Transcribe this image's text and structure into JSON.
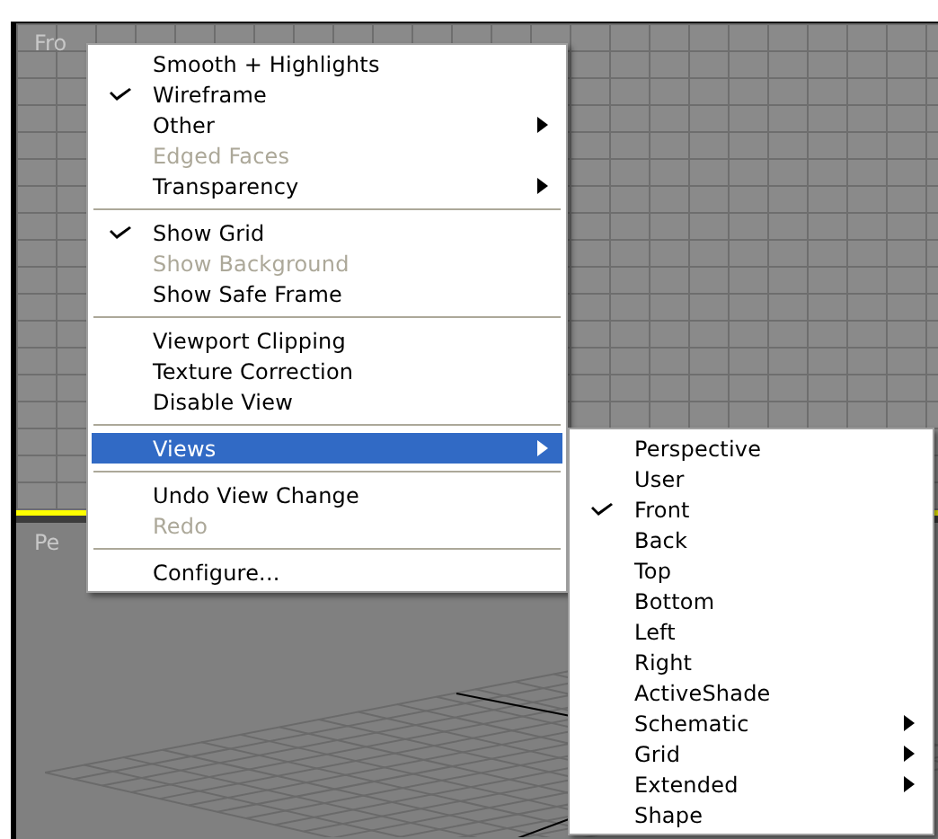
{
  "viewports": [
    {
      "label": "Fro",
      "kind": "orthographic",
      "active": true
    },
    {
      "label": "Pe",
      "kind": "perspective",
      "active": false
    }
  ],
  "menu": {
    "items": [
      {
        "kind": "item",
        "label": "Smooth + Highlights",
        "checked": false,
        "disabled": false,
        "submenu": false,
        "selected": false
      },
      {
        "kind": "item",
        "label": "Wireframe",
        "checked": true,
        "disabled": false,
        "submenu": false,
        "selected": false
      },
      {
        "kind": "item",
        "label": "Other",
        "checked": false,
        "disabled": false,
        "submenu": true,
        "selected": false
      },
      {
        "kind": "item",
        "label": "Edged Faces",
        "checked": false,
        "disabled": true,
        "submenu": false,
        "selected": false
      },
      {
        "kind": "item",
        "label": "Transparency",
        "checked": false,
        "disabled": false,
        "submenu": true,
        "selected": false
      },
      {
        "kind": "separator"
      },
      {
        "kind": "item",
        "label": "Show Grid",
        "checked": true,
        "disabled": false,
        "submenu": false,
        "selected": false
      },
      {
        "kind": "item",
        "label": "Show Background",
        "checked": false,
        "disabled": true,
        "submenu": false,
        "selected": false
      },
      {
        "kind": "item",
        "label": "Show Safe Frame",
        "checked": false,
        "disabled": false,
        "submenu": false,
        "selected": false
      },
      {
        "kind": "separator"
      },
      {
        "kind": "item",
        "label": "Viewport Clipping",
        "checked": false,
        "disabled": false,
        "submenu": false,
        "selected": false
      },
      {
        "kind": "item",
        "label": "Texture Correction",
        "checked": false,
        "disabled": false,
        "submenu": false,
        "selected": false
      },
      {
        "kind": "item",
        "label": "Disable View",
        "checked": false,
        "disabled": false,
        "submenu": false,
        "selected": false
      },
      {
        "kind": "separator"
      },
      {
        "kind": "item",
        "label": "Views",
        "checked": false,
        "disabled": false,
        "submenu": true,
        "selected": true
      },
      {
        "kind": "separator"
      },
      {
        "kind": "item",
        "label": "Undo View Change",
        "checked": false,
        "disabled": false,
        "submenu": false,
        "selected": false
      },
      {
        "kind": "item",
        "label": "Redo",
        "checked": false,
        "disabled": true,
        "submenu": false,
        "selected": false
      },
      {
        "kind": "separator"
      },
      {
        "kind": "item",
        "label": "Configure...",
        "checked": false,
        "disabled": false,
        "submenu": false,
        "selected": false
      }
    ]
  },
  "submenu": {
    "items": [
      {
        "kind": "item",
        "label": "Perspective",
        "checked": false,
        "disabled": false,
        "submenu": false,
        "selected": false
      },
      {
        "kind": "item",
        "label": "User",
        "checked": false,
        "disabled": false,
        "submenu": false,
        "selected": false
      },
      {
        "kind": "item",
        "label": "Front",
        "checked": true,
        "disabled": false,
        "submenu": false,
        "selected": false
      },
      {
        "kind": "item",
        "label": "Back",
        "checked": false,
        "disabled": false,
        "submenu": false,
        "selected": false
      },
      {
        "kind": "item",
        "label": "Top",
        "checked": false,
        "disabled": false,
        "submenu": false,
        "selected": false
      },
      {
        "kind": "item",
        "label": "Bottom",
        "checked": false,
        "disabled": false,
        "submenu": false,
        "selected": false
      },
      {
        "kind": "item",
        "label": "Left",
        "checked": false,
        "disabled": false,
        "submenu": false,
        "selected": false
      },
      {
        "kind": "item",
        "label": "Right",
        "checked": false,
        "disabled": false,
        "submenu": false,
        "selected": false
      },
      {
        "kind": "item",
        "label": "ActiveShade",
        "checked": false,
        "disabled": false,
        "submenu": false,
        "selected": false
      },
      {
        "kind": "item",
        "label": "Schematic",
        "checked": false,
        "disabled": false,
        "submenu": true,
        "selected": false
      },
      {
        "kind": "item",
        "label": "Grid",
        "checked": false,
        "disabled": false,
        "submenu": true,
        "selected": false
      },
      {
        "kind": "item",
        "label": "Extended",
        "checked": false,
        "disabled": false,
        "submenu": true,
        "selected": false
      },
      {
        "kind": "item",
        "label": "Shape",
        "checked": false,
        "disabled": false,
        "submenu": false,
        "selected": false
      }
    ]
  }
}
